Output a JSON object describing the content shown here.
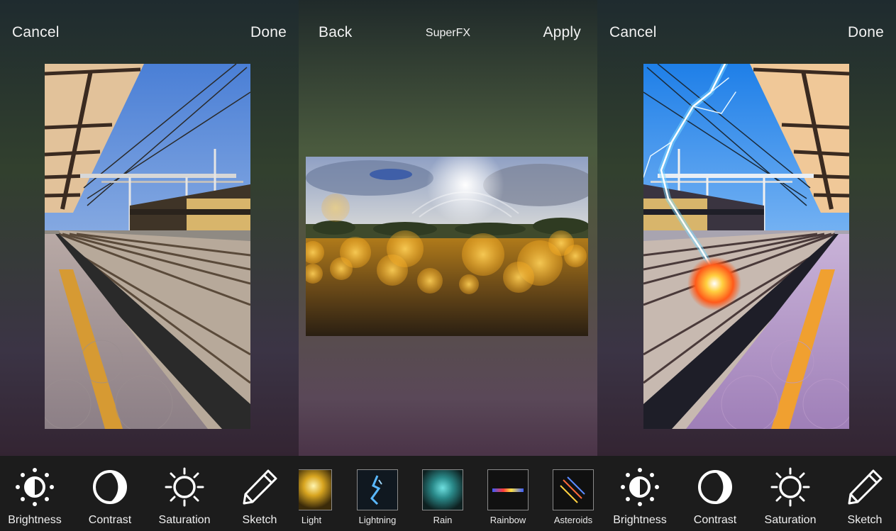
{
  "left_panel": {
    "cancel_label": "Cancel",
    "done_label": "Done",
    "tools": [
      {
        "label": "Brightness",
        "icon": "brightness-icon"
      },
      {
        "label": "Contrast",
        "icon": "contrast-icon"
      },
      {
        "label": "Saturation",
        "icon": "saturation-icon"
      },
      {
        "label": "Sketch",
        "icon": "pencil-icon"
      }
    ]
  },
  "middle_panel": {
    "back_label": "Back",
    "title": "SuperFX",
    "apply_label": "Apply",
    "effects": [
      {
        "label": "Light",
        "icon": "light-thumb"
      },
      {
        "label": "Lightning",
        "icon": "lightning-thumb"
      },
      {
        "label": "Rain",
        "icon": "rain-thumb"
      },
      {
        "label": "Rainbow",
        "icon": "rainbow-thumb"
      },
      {
        "label": "Asteroids",
        "icon": "asteroids-thumb"
      }
    ]
  },
  "right_panel": {
    "cancel_label": "Cancel",
    "done_label": "Done",
    "tools": [
      {
        "label": "Brightness",
        "icon": "brightness-icon"
      },
      {
        "label": "Contrast",
        "icon": "contrast-icon"
      },
      {
        "label": "Saturation",
        "icon": "saturation-icon"
      },
      {
        "label": "Sketch",
        "icon": "pencil-icon"
      }
    ]
  },
  "colors": {
    "toolbar_bg": "#1c1c1c",
    "text": "#f2f2f2"
  }
}
